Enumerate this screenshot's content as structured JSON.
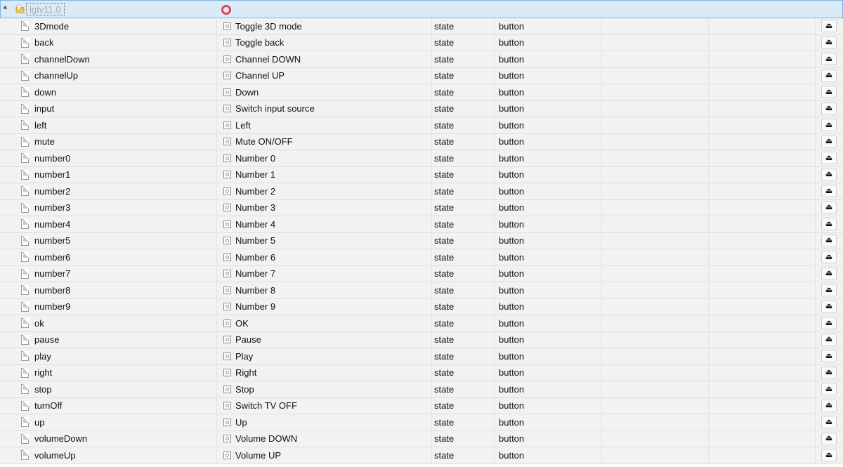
{
  "root": {
    "label": "lgtv11.0",
    "expander_icon": "expanded-triangle-icon",
    "folder_icon": "folder-icon",
    "role_icon": "role-circle-icon",
    "role_color": "#e0455c"
  },
  "rows": [
    {
      "id": "3Dmode",
      "name": "Toggle 3D mode",
      "type": "state",
      "role": "button"
    },
    {
      "id": "back",
      "name": "Toggle back",
      "type": "state",
      "role": "button"
    },
    {
      "id": "channelDown",
      "name": "Channel DOWN",
      "type": "state",
      "role": "button"
    },
    {
      "id": "channelUp",
      "name": "Channel UP",
      "type": "state",
      "role": "button"
    },
    {
      "id": "down",
      "name": "Down",
      "type": "state",
      "role": "button"
    },
    {
      "id": "input",
      "name": "Switch input source",
      "type": "state",
      "role": "button"
    },
    {
      "id": "left",
      "name": "Left",
      "type": "state",
      "role": "button"
    },
    {
      "id": "mute",
      "name": "Mute ON/OFF",
      "type": "state",
      "role": "button"
    },
    {
      "id": "number0",
      "name": "Number 0",
      "type": "state",
      "role": "button"
    },
    {
      "id": "number1",
      "name": "Number 1",
      "type": "state",
      "role": "button"
    },
    {
      "id": "number2",
      "name": "Number 2",
      "type": "state",
      "role": "button"
    },
    {
      "id": "number3",
      "name": "Number 3",
      "type": "state",
      "role": "button"
    },
    {
      "id": "number4",
      "name": "Number 4",
      "type": "state",
      "role": "button"
    },
    {
      "id": "number5",
      "name": "Number 5",
      "type": "state",
      "role": "button"
    },
    {
      "id": "number6",
      "name": "Number 6",
      "type": "state",
      "role": "button"
    },
    {
      "id": "number7",
      "name": "Number 7",
      "type": "state",
      "role": "button"
    },
    {
      "id": "number8",
      "name": "Number 8",
      "type": "state",
      "role": "button"
    },
    {
      "id": "number9",
      "name": "Number 9",
      "type": "state",
      "role": "button"
    },
    {
      "id": "ok",
      "name": "OK",
      "type": "state",
      "role": "button"
    },
    {
      "id": "pause",
      "name": "Pause",
      "type": "state",
      "role": "button"
    },
    {
      "id": "play",
      "name": "Play",
      "type": "state",
      "role": "button"
    },
    {
      "id": "right",
      "name": "Right",
      "type": "state",
      "role": "button"
    },
    {
      "id": "stop",
      "name": "Stop",
      "type": "state",
      "role": "button"
    },
    {
      "id": "turnOff",
      "name": "Switch TV OFF",
      "type": "state",
      "role": "button"
    },
    {
      "id": "up",
      "name": "Up",
      "type": "state",
      "role": "button"
    },
    {
      "id": "volumeDown",
      "name": "Volume DOWN",
      "type": "state",
      "role": "button"
    },
    {
      "id": "volumeUp",
      "name": "Volume UP",
      "type": "state",
      "role": "button"
    }
  ],
  "icons": {
    "file": "file-icon",
    "state": "state-icon",
    "action": "eject-icon",
    "action_glyph": "⏏"
  }
}
